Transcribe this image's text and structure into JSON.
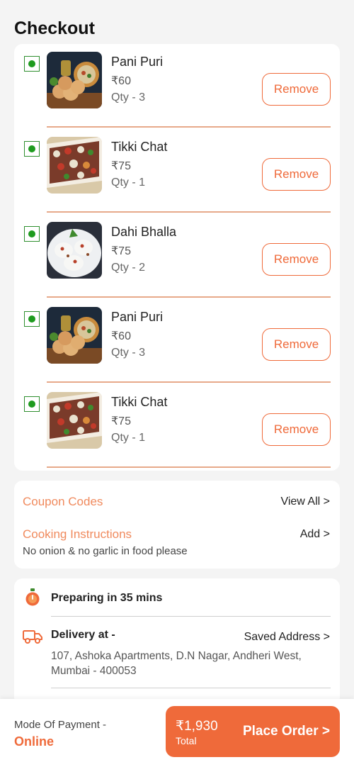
{
  "header": {
    "title": "Checkout"
  },
  "cart": {
    "items": [
      {
        "name": "Pani Puri",
        "price": "₹60",
        "qty": "Qty - 3",
        "remove_label": "Remove",
        "image": "pani-puri"
      },
      {
        "name": "Tikki Chat",
        "price": "₹75",
        "qty": "Qty - 1",
        "remove_label": "Remove",
        "image": "tikki-chat"
      },
      {
        "name": "Dahi Bhalla",
        "price": "₹75",
        "qty": "Qty - 2",
        "remove_label": "Remove",
        "image": "dahi-bhalla"
      },
      {
        "name": "Pani Puri",
        "price": "₹60",
        "qty": "Qty - 3",
        "remove_label": "Remove",
        "image": "pani-puri"
      },
      {
        "name": "Tikki Chat",
        "price": "₹75",
        "qty": "Qty - 1",
        "remove_label": "Remove",
        "image": "tikki-chat"
      }
    ]
  },
  "extras": {
    "coupon_label": "Coupon Codes",
    "coupon_action": "View All >",
    "instructions_label": "Cooking Instructions",
    "instructions_action": "Add >",
    "instructions_text": "No onion & no garlic in food please"
  },
  "delivery": {
    "preparing": "Preparing in 35 mins",
    "delivery_label": "Delivery at -",
    "saved_address_link": "Saved Address >",
    "address": "107, Ashoka Apartments, D.N Nagar, Andheri West, Mumbai - 400053"
  },
  "footer": {
    "mode_label": "Mode Of Payment -",
    "mode_value": "Online",
    "total_amount": "₹1,930",
    "total_label": "Total",
    "place_order": "Place Order >"
  },
  "colors": {
    "accent": "#ef6a3a",
    "accent_light": "#f08a5d",
    "veg_green": "#1e9b1e",
    "background": "#f4f4f4"
  },
  "icons": {
    "veg": "veg-indicator-icon",
    "timer": "timer-icon",
    "truck": "delivery-truck-icon"
  }
}
